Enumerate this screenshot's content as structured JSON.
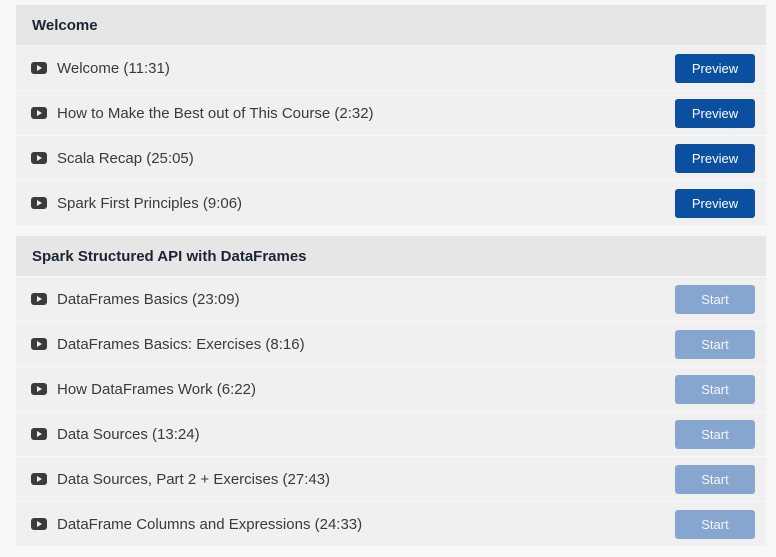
{
  "sections": [
    {
      "title": "Welcome",
      "lectures": [
        {
          "title": "Welcome (11:31)",
          "action": "Preview"
        },
        {
          "title": "How to Make the Best out of This Course (2:32)",
          "action": "Preview"
        },
        {
          "title": "Scala Recap (25:05)",
          "action": "Preview"
        },
        {
          "title": "Spark First Principles (9:06)",
          "action": "Preview"
        }
      ]
    },
    {
      "title": "Spark Structured API with DataFrames",
      "lectures": [
        {
          "title": "DataFrames Basics (23:09)",
          "action": "Start"
        },
        {
          "title": "DataFrames Basics: Exercises (8:16)",
          "action": "Start"
        },
        {
          "title": "How DataFrames Work (6:22)",
          "action": "Start"
        },
        {
          "title": "Data Sources (13:24)",
          "action": "Start"
        },
        {
          "title": "Data Sources, Part 2 + Exercises (27:43)",
          "action": "Start"
        },
        {
          "title": "DataFrame Columns and Expressions (24:33)",
          "action": "Start"
        }
      ]
    }
  ],
  "colors": {
    "preview_button": "#0b4fa0",
    "start_button": "#86a5cf",
    "section_header_bg": "#e6e6e6",
    "row_bg": "#f0f0f0"
  },
  "icons": {
    "lecture": "play-video-icon"
  }
}
